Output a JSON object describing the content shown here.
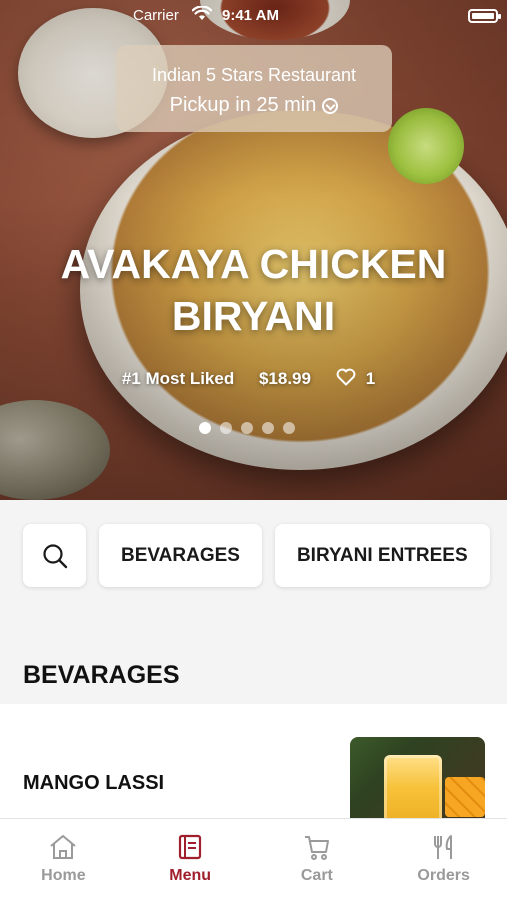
{
  "status_bar": {
    "carrier": "Carrier",
    "time": "9:41 AM"
  },
  "restaurant": {
    "name": "Indian 5 Stars Restaurant",
    "pickup": "Pickup in 25 min"
  },
  "hero": {
    "title_line1": "AVAKAYA CHICKEN",
    "title_line2": "BIRYANI",
    "badge": "#1 Most Liked",
    "price": "$18.99",
    "likes": "1",
    "slides_total": 5,
    "slide_active": 1
  },
  "categories": {
    "search_icon": "search-icon",
    "items": [
      "BEVARAGES",
      "BIRYANI ENTREES"
    ]
  },
  "section": {
    "title": "BEVARAGES"
  },
  "menu_items": [
    {
      "name": "MANGO LASSI"
    }
  ],
  "tabs": [
    {
      "label": "Home",
      "icon": "home-icon"
    },
    {
      "label": "Menu",
      "icon": "menu-icon",
      "active": true
    },
    {
      "label": "Cart",
      "icon": "cart-icon"
    },
    {
      "label": "Orders",
      "icon": "fork-knife-icon"
    }
  ],
  "colors": {
    "accent": "#a01f2d",
    "inactive": "#9a9a9a"
  }
}
